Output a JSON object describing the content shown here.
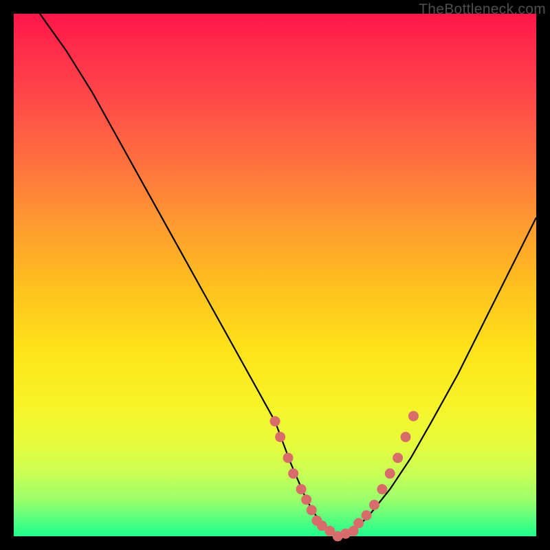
{
  "watermark": {
    "text": "TheBottleneck.com"
  },
  "colors": {
    "background": "#000000",
    "curve": "#000000",
    "dots": "#d96b6b",
    "gradient_stops": [
      "#ff1549",
      "#ff2a4a",
      "#ff4849",
      "#ff6f3f",
      "#ff9a30",
      "#ffc01e",
      "#ffe21a",
      "#f8f325",
      "#e8fb3a",
      "#c9ff55",
      "#9bff6a",
      "#5cff7e",
      "#1bff8c"
    ]
  },
  "chart_data": {
    "type": "line",
    "title": "",
    "xlabel": "",
    "ylabel": "",
    "xlim": [
      0,
      100
    ],
    "ylim": [
      0,
      100
    ],
    "grid": false,
    "legend": false,
    "description": "V-shaped bottleneck curve overlaid on vertical red-to-green gradient; minimum (best balance) sits in the green band near x≈57-65. Left branch is steeper than right branch. Salmon-colored dots cluster around the trough.",
    "series": [
      {
        "name": "bottleneck-curve",
        "x": [
          5,
          10,
          15,
          20,
          25,
          30,
          35,
          40,
          45,
          50,
          53,
          56,
          59,
          62,
          65,
          68,
          72,
          76,
          80,
          85,
          90,
          95,
          100
        ],
        "values": [
          100,
          93,
          85,
          76,
          67,
          58,
          49,
          40,
          31,
          22,
          14,
          7,
          2,
          0,
          1,
          4,
          9,
          15,
          22,
          31,
          41,
          51,
          61
        ]
      }
    ],
    "annotations": {
      "trough_dots": [
        {
          "x": 50,
          "y": 22
        },
        {
          "x": 51,
          "y": 19
        },
        {
          "x": 52.5,
          "y": 15
        },
        {
          "x": 53.5,
          "y": 12
        },
        {
          "x": 55,
          "y": 9
        },
        {
          "x": 56,
          "y": 7
        },
        {
          "x": 57,
          "y": 5
        },
        {
          "x": 58,
          "y": 3
        },
        {
          "x": 59,
          "y": 2
        },
        {
          "x": 60.5,
          "y": 1
        },
        {
          "x": 62,
          "y": 0
        },
        {
          "x": 63.5,
          "y": 0.5
        },
        {
          "x": 65,
          "y": 1
        },
        {
          "x": 66,
          "y": 2.5
        },
        {
          "x": 67.5,
          "y": 4
        },
        {
          "x": 69,
          "y": 6
        },
        {
          "x": 70.5,
          "y": 9
        },
        {
          "x": 72,
          "y": 12
        },
        {
          "x": 73.5,
          "y": 15
        },
        {
          "x": 75,
          "y": 19
        },
        {
          "x": 76.5,
          "y": 23
        }
      ]
    }
  }
}
